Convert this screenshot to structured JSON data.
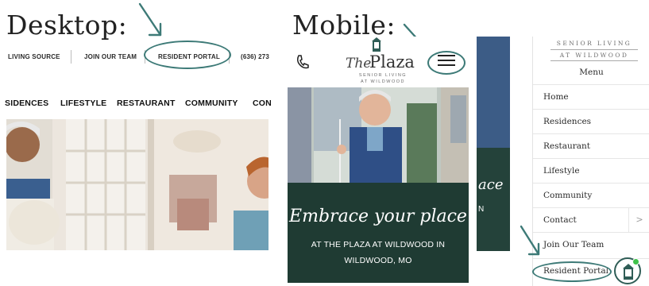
{
  "labels": {
    "desktop": "Desktop:",
    "mobile": "Mobile:"
  },
  "desktop": {
    "top_nav": {
      "living_source": "LIVING SOURCE",
      "join_our_team": "JOIN OUR TEAM",
      "resident_portal": "RESIDENT PORTAL",
      "phone": "(636) 273"
    },
    "main_nav": [
      "SIDENCES",
      "LIFESTYLE",
      "RESTAURANT",
      "COMMUNITY",
      "CON"
    ]
  },
  "mobile": {
    "logo_the": "The",
    "logo_plaza": "Plaza",
    "logo_sub1": "SENIOR LIVING",
    "logo_sub2": "AT WILDWOOD",
    "hero_heading": "Embrace your place",
    "hero_subtitle_line1": "AT THE PLAZA AT WILDWOOD IN",
    "hero_subtitle_line2": "WILDWOOD, MO",
    "partial_text_1": "ace",
    "partial_text_2": "N"
  },
  "menu": {
    "brand_line1": "SENIOR LIVING",
    "brand_line2": "AT WILDWOOD",
    "title": "Menu",
    "items": [
      "Home",
      "Residences",
      "Restaurant",
      "Lifestyle",
      "Community",
      "Contact",
      "Join Our Team",
      "Resident Portal"
    ],
    "contact_chevron": ">"
  },
  "colors": {
    "accent_teal": "#3d7a77",
    "hero_green": "#1f3b33",
    "badge_dot": "#3fc34a"
  },
  "icons": {
    "phone": "phone-icon",
    "hamburger": "hamburger-menu-icon",
    "lantern": "lantern-icon"
  }
}
